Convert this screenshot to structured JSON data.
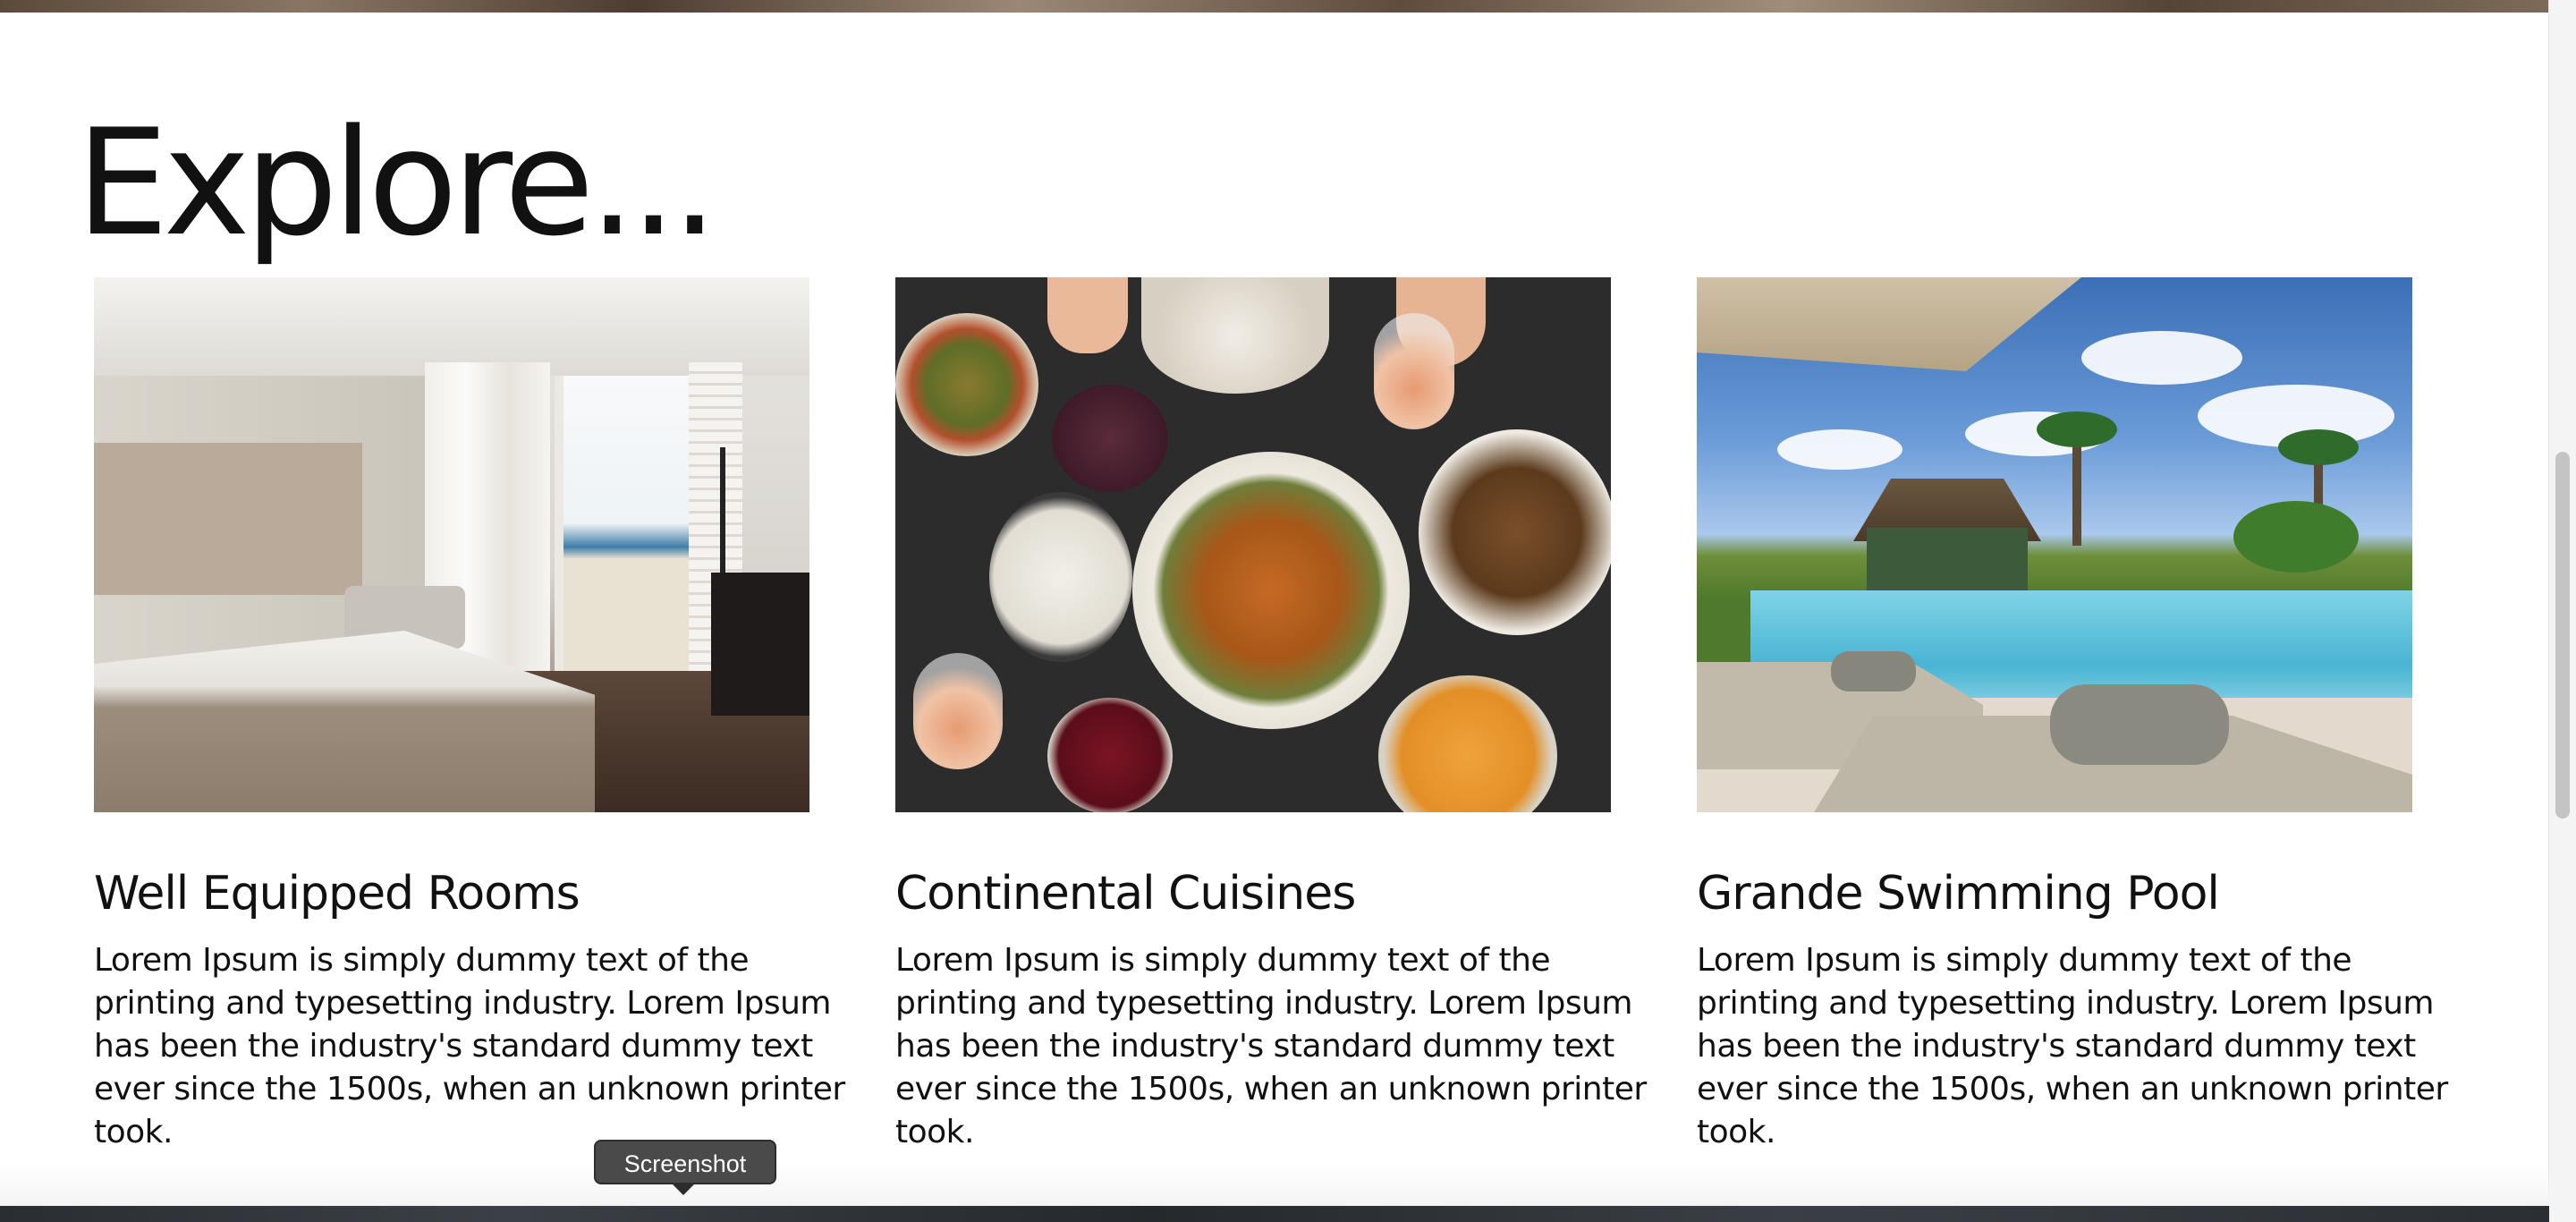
{
  "page": {
    "heading": "Explore..."
  },
  "cards": [
    {
      "title": "Well Equipped Rooms",
      "description": "Lorem Ipsum is simply dummy text of the printing and typesetting industry. Lorem Ipsum has been the industry's standard dummy text ever since the 1500s, when an unknown printer took."
    },
    {
      "title": "Continental Cuisines",
      "description": "Lorem Ipsum is simply dummy text of the printing and typesetting industry. Lorem Ipsum has been the industry's standard dummy text ever since the 1500s, when an unknown printer took."
    },
    {
      "title": "Grande Swimming Pool",
      "description": "Lorem Ipsum is simply dummy text of the printing and typesetting industry. Lorem Ipsum has been the industry's standard dummy text ever since the 1500s, when an unknown printer took."
    }
  ],
  "tooltip": {
    "label": "Screenshot"
  },
  "colors": {
    "text": "#111111",
    "background": "#ffffff",
    "tooltip_bg": "#4a4a4a"
  }
}
